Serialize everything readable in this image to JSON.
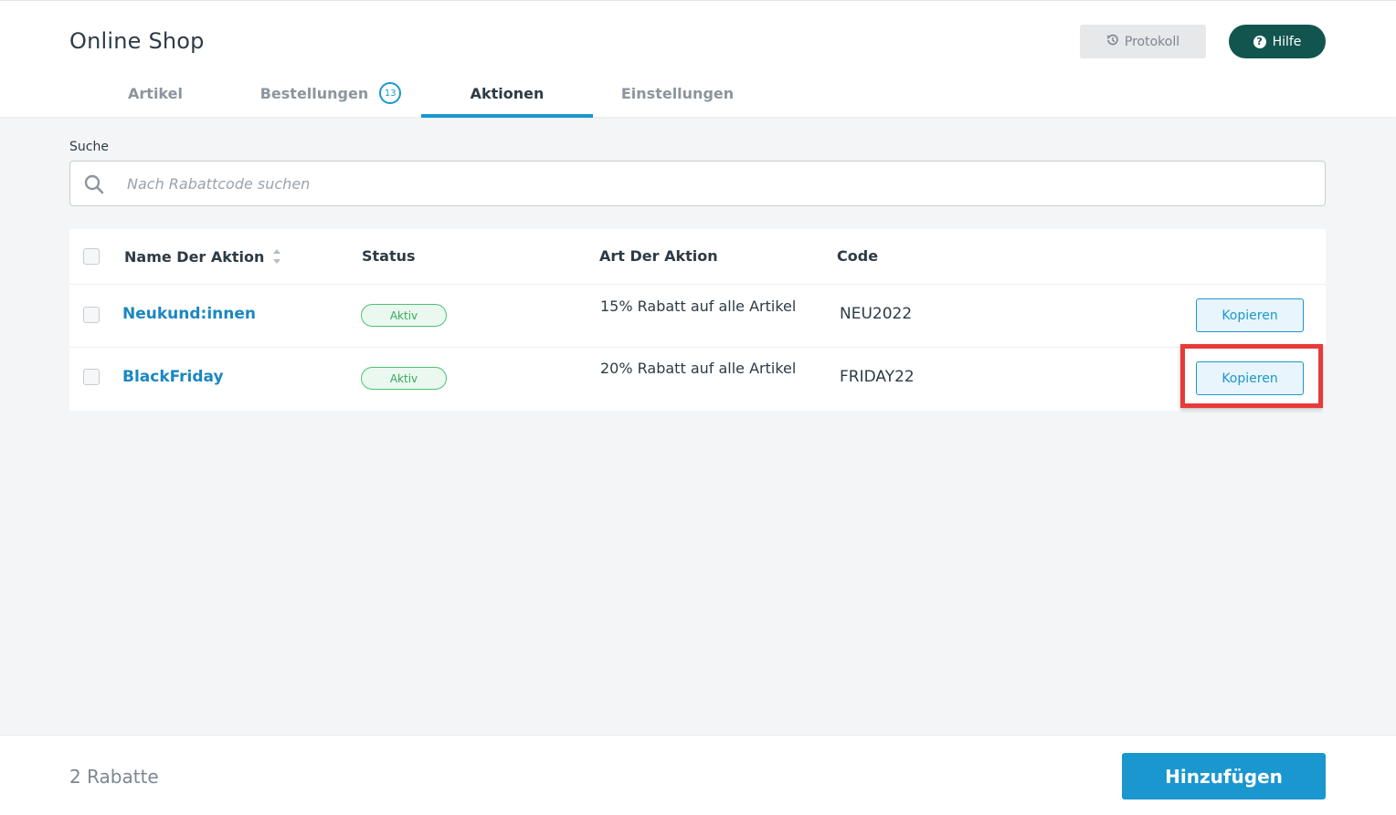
{
  "header": {
    "title": "Online Shop",
    "protokoll_label": "Protokoll",
    "hilfe_label": "Hilfe"
  },
  "tabs": [
    {
      "label": "Artikel"
    },
    {
      "label": "Bestellungen",
      "badge": "13"
    },
    {
      "label": "Aktionen",
      "active": true
    },
    {
      "label": "Einstellungen"
    }
  ],
  "search": {
    "label": "Suche",
    "placeholder": "Nach Rabattcode suchen",
    "value": ""
  },
  "table": {
    "columns": [
      "Name Der Aktion",
      "Status",
      "Art Der Aktion",
      "Code"
    ],
    "rows": [
      {
        "name": "Neukund:innen",
        "status": "Aktiv",
        "art": "15% Rabatt auf alle Artikel",
        "code": "NEU2022",
        "action": "Kopieren"
      },
      {
        "name": "BlackFriday",
        "status": "Aktiv",
        "art": "20% Rabatt auf alle Artikel",
        "code": "FRIDAY22",
        "action": "Kopieren"
      }
    ]
  },
  "footer": {
    "count_label": "2 Rabatte",
    "add_label": "Hinzufügen"
  },
  "colors": {
    "accent": "#1a97cf",
    "help_button": "#12554f",
    "status_green": "#4cc174",
    "highlight": "#e83a3a"
  },
  "icons": {
    "protokoll": "history-icon",
    "hilfe": "question-circle-icon",
    "search": "search-icon",
    "sort": "sort-icon"
  }
}
